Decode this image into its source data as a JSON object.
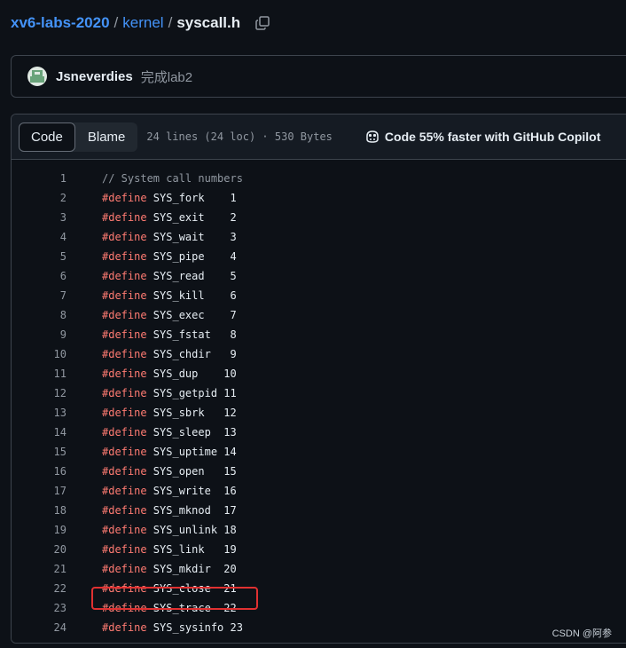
{
  "breadcrumb": {
    "repo": "xv6-labs-2020",
    "folder": "kernel",
    "file": "syscall.h",
    "sep1": "/",
    "sep2": "/"
  },
  "commit": {
    "author": "Jsneverdies",
    "message": "完成lab2"
  },
  "toolbar": {
    "code_tab": "Code",
    "blame_tab": "Blame",
    "file_info": "24 lines (24 loc) · 530 Bytes",
    "copilot_text": "Code 55% faster with GitHub Copilot"
  },
  "code": {
    "lines": [
      {
        "num": "1",
        "kw": "",
        "text": "// System call numbers"
      },
      {
        "num": "2",
        "kw": "#define",
        "text": " SYS_fork    1"
      },
      {
        "num": "3",
        "kw": "#define",
        "text": " SYS_exit    2"
      },
      {
        "num": "4",
        "kw": "#define",
        "text": " SYS_wait    3"
      },
      {
        "num": "5",
        "kw": "#define",
        "text": " SYS_pipe    4"
      },
      {
        "num": "6",
        "kw": "#define",
        "text": " SYS_read    5"
      },
      {
        "num": "7",
        "kw": "#define",
        "text": " SYS_kill    6"
      },
      {
        "num": "8",
        "kw": "#define",
        "text": " SYS_exec    7"
      },
      {
        "num": "9",
        "kw": "#define",
        "text": " SYS_fstat   8"
      },
      {
        "num": "10",
        "kw": "#define",
        "text": " SYS_chdir   9"
      },
      {
        "num": "11",
        "kw": "#define",
        "text": " SYS_dup    10"
      },
      {
        "num": "12",
        "kw": "#define",
        "text": " SYS_getpid 11"
      },
      {
        "num": "13",
        "kw": "#define",
        "text": " SYS_sbrk   12"
      },
      {
        "num": "14",
        "kw": "#define",
        "text": " SYS_sleep  13"
      },
      {
        "num": "15",
        "kw": "#define",
        "text": " SYS_uptime 14"
      },
      {
        "num": "16",
        "kw": "#define",
        "text": " SYS_open   15"
      },
      {
        "num": "17",
        "kw": "#define",
        "text": " SYS_write  16"
      },
      {
        "num": "18",
        "kw": "#define",
        "text": " SYS_mknod  17"
      },
      {
        "num": "19",
        "kw": "#define",
        "text": " SYS_unlink 18"
      },
      {
        "num": "20",
        "kw": "#define",
        "text": " SYS_link   19"
      },
      {
        "num": "21",
        "kw": "#define",
        "text": " SYS_mkdir  20"
      },
      {
        "num": "22",
        "kw": "#define",
        "text": " SYS_close  21"
      },
      {
        "num": "23",
        "kw": "#define",
        "text": " SYS_trace  22"
      },
      {
        "num": "24",
        "kw": "#define",
        "text": " SYS_sysinfo 23"
      }
    ]
  },
  "watermark": "CSDN @阿参",
  "colors": {
    "background": "#0d1117",
    "link": "#4493f8",
    "keyword": "#ff7b72",
    "highlight_box": "#e03131"
  },
  "icons": {
    "copy": "copy-icon",
    "copilot": "copilot-icon",
    "avatar": "avatar"
  }
}
